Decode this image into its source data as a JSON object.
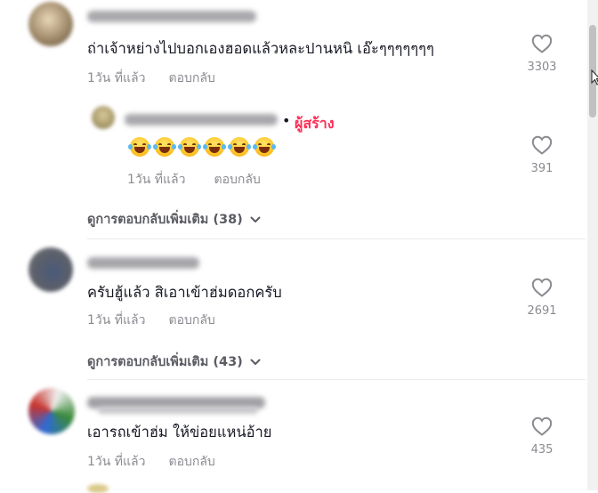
{
  "comments": [
    {
      "text": "ถ่าเจ้าหย่างไปบอกเองฮอดแล้วหละปานหนิ เอ๊ะๆๆๆๆๆๆๆ",
      "time": "1วัน ที่แล้ว",
      "reply_label": "ตอบกลับ",
      "likes": "3303"
    },
    {
      "text": "ครับฮู้แล้ว สิเอาเข้าฮ่มดอกครับ",
      "time": "1วัน ที่แล้ว",
      "reply_label": "ตอบกลับ",
      "likes": "2691",
      "more_replies": "ดูการตอบกลับเพิ่มเติม (43)"
    },
    {
      "text": "เอารถเข้าฮ่ม ให้ข่อยแหน่อ้าย",
      "time": "1วัน ที่แล้ว",
      "reply_label": "ตอบกลับ",
      "likes": "435"
    }
  ],
  "creator_reply": {
    "separator": "•",
    "creator_badge": "ผู้สร้าง",
    "emojis": [
      "😂",
      "😂",
      "😂",
      "😂",
      "😂",
      "😂"
    ],
    "time": "1วัน ที่แล้ว",
    "reply_label": "ตอบกลับ",
    "likes": "391"
  },
  "first_more_replies": "ดูการตอบกลับเพิ่มเติม (38)",
  "icons": {
    "like": "heart-outline-icon",
    "expand": "chevron-down-icon",
    "emoji": "face-with-tears-of-joy-icon",
    "cursor": "mouse-pointer-icon"
  },
  "colors": {
    "creator": "#fe2c55",
    "meta": "#8a8b91",
    "text": "#161823"
  }
}
